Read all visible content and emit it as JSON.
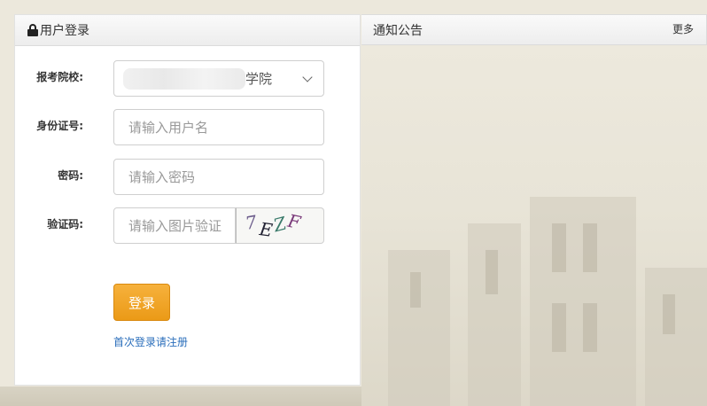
{
  "login": {
    "title": "用户登录",
    "school_label": "报考院校:",
    "school_value": "学院",
    "id_label": "身份证号:",
    "id_placeholder": "请输入用户名",
    "password_label": "密码:",
    "password_placeholder": "请输入密码",
    "captcha_label": "验证码:",
    "captcha_placeholder": "请输入图片验证",
    "captcha_chars": [
      "7",
      "E",
      "Z",
      "F"
    ],
    "submit_label": "登录",
    "register_link": "首次登录请注册"
  },
  "notice": {
    "title": "通知公告",
    "more_label": "更多"
  },
  "colors": {
    "accent_button": "#eb9a17",
    "link": "#2a6ebb",
    "background": "#ece8dc"
  }
}
